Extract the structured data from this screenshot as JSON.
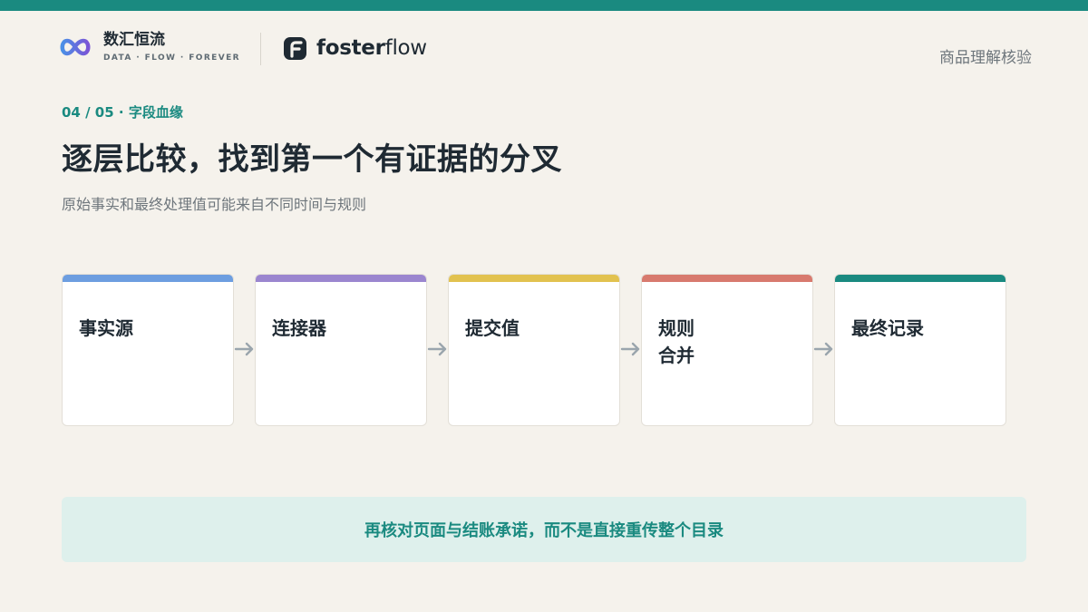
{
  "brand": {
    "name": "数汇恒流",
    "tagline": "DATA · FLOW · FOREVER",
    "logo_icon": "infinity-icon",
    "accent": "#1a8a80"
  },
  "partner": {
    "name_bold": "foster",
    "name_light": "flow",
    "logo_icon": "f-mark-icon"
  },
  "corner_label": "商品理解核验",
  "section_label": "04 / 05 · 字段血缘",
  "title": "逐层比较，找到第一个有证据的分叉",
  "subtitle": "原始事实和最终处理值可能来自不同时间与规则",
  "flow": {
    "steps": [
      {
        "label": "事实源",
        "color": "#6d9ee0"
      },
      {
        "label": "连接器",
        "color": "#9b86cf"
      },
      {
        "label": "提交值",
        "color": "#e2c24f"
      },
      {
        "label": "规则\n合并",
        "color": "#d87a6e"
      },
      {
        "label": "最终记录",
        "color": "#1a8a80"
      }
    ],
    "arrow_icon": "arrow-right-icon"
  },
  "note": "再核对页面与结账承诺，而不是直接重传整个目录"
}
